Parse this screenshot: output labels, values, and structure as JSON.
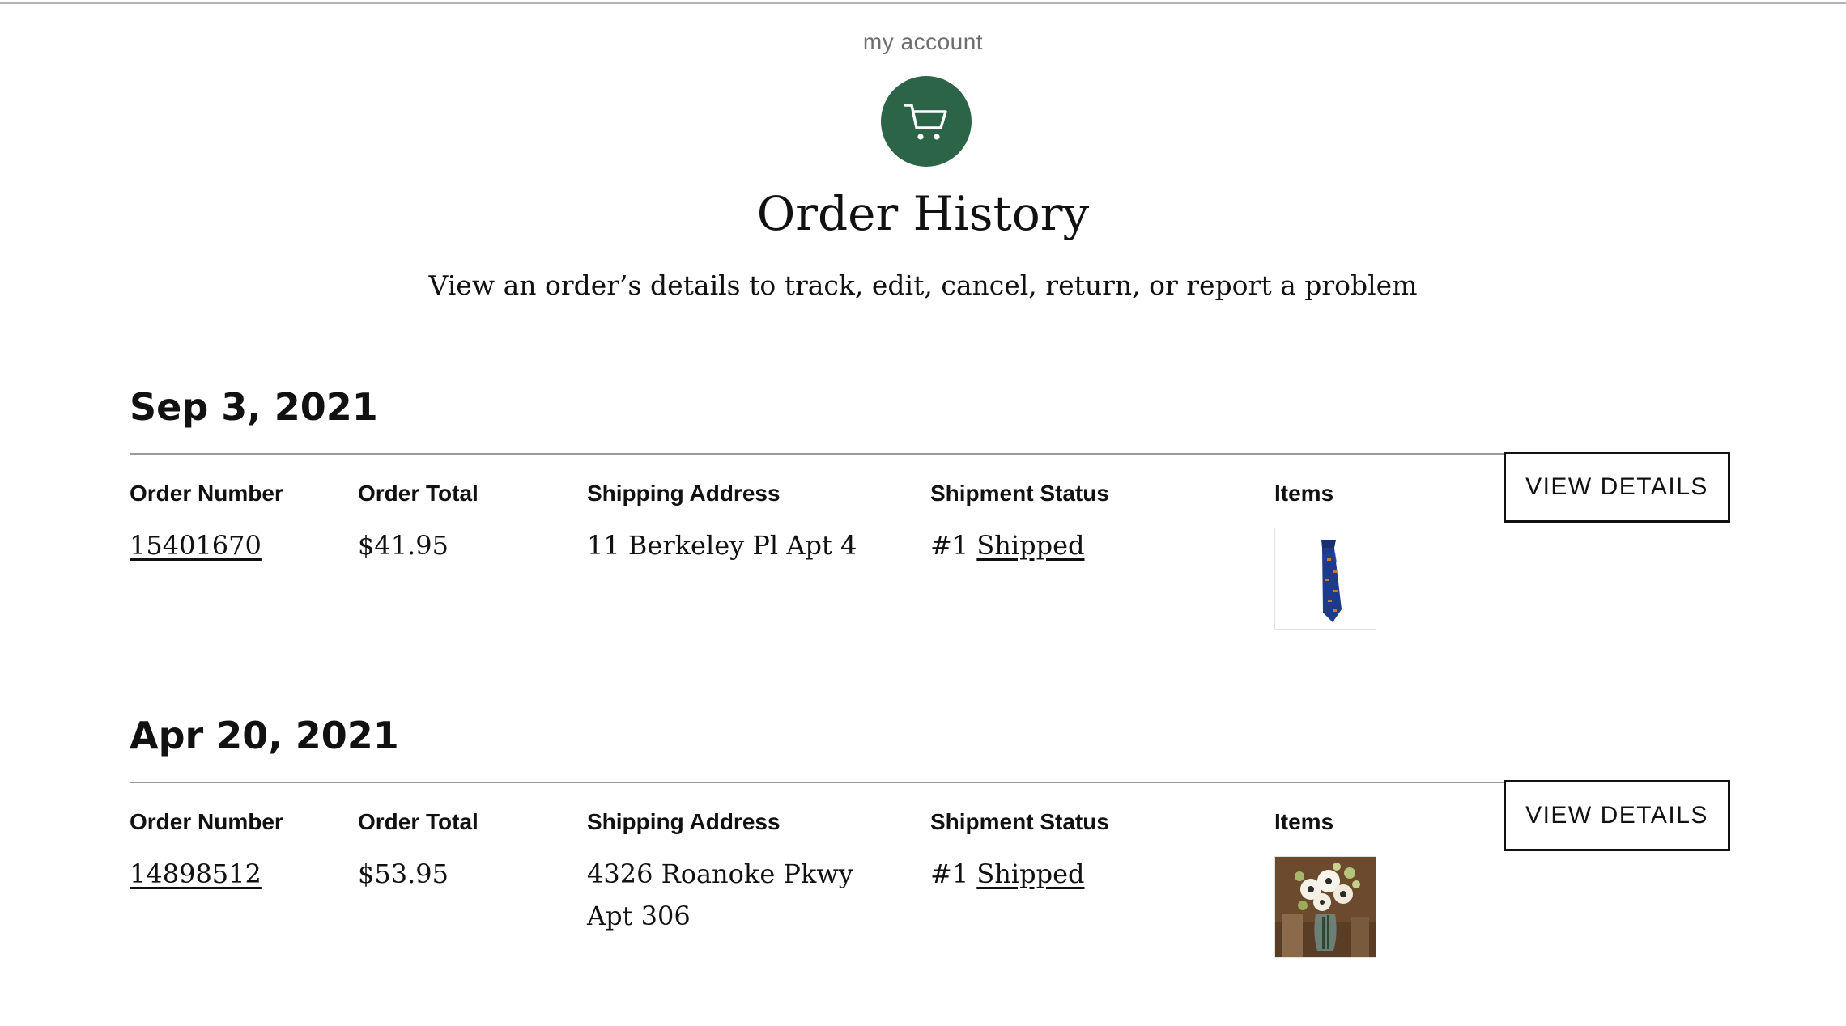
{
  "header": {
    "eyebrow": "my account",
    "title": "Order History",
    "subtitle": "View an order’s details to track, edit, cancel, return, or report a problem",
    "badge_icon": "shopping-cart-icon",
    "badge_color": "#2c6447"
  },
  "columns": {
    "order_number": "Order Number",
    "order_total": "Order Total",
    "shipping_address": "Shipping Address",
    "shipment_status": "Shipment Status",
    "items": "Items"
  },
  "orders": [
    {
      "date": "Sep 3, 2021",
      "order_number": "15401670",
      "order_total": "$41.95",
      "shipping_address": "11 Berkeley Pl Apt 4",
      "shipment_prefix": "#1",
      "shipment_status": "Shipped",
      "item_image": "necktie-product-image",
      "view_label": "VIEW DETAILS"
    },
    {
      "date": "Apr 20, 2021",
      "order_number": "14898512",
      "order_total": "$53.95",
      "shipping_address": "4326 Roanoke Pkwy Apt 306",
      "shipment_prefix": "#1",
      "shipment_status": "Shipped",
      "item_image": "flower-vase-product-image",
      "view_label": "VIEW DETAILS"
    }
  ]
}
